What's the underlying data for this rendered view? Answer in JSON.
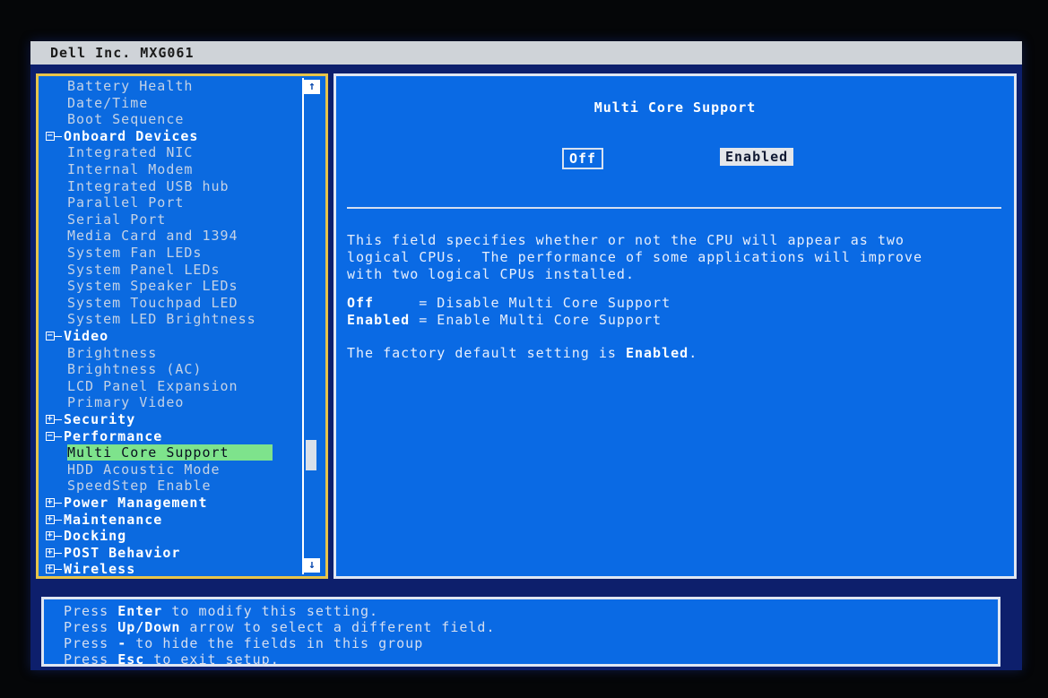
{
  "window": {
    "title": "Dell Inc. MXG061"
  },
  "tree": {
    "items": [
      {
        "label": "Battery Health",
        "level": "sub"
      },
      {
        "label": "Date/Time",
        "level": "sub"
      },
      {
        "label": "Boot Sequence",
        "level": "sub"
      },
      {
        "label": "Onboard Devices",
        "level": "group",
        "expander": "−"
      },
      {
        "label": "Integrated NIC",
        "level": "sub"
      },
      {
        "label": "Internal Modem",
        "level": "sub"
      },
      {
        "label": "Integrated USB hub",
        "level": "sub"
      },
      {
        "label": "Parallel Port",
        "level": "sub"
      },
      {
        "label": "Serial Port",
        "level": "sub"
      },
      {
        "label": "Media Card and 1394",
        "level": "sub"
      },
      {
        "label": "System Fan LEDs",
        "level": "sub"
      },
      {
        "label": "System Panel LEDs",
        "level": "sub"
      },
      {
        "label": "System Speaker LEDs",
        "level": "sub"
      },
      {
        "label": "System Touchpad LED",
        "level": "sub"
      },
      {
        "label": "System LED Brightness",
        "level": "sub"
      },
      {
        "label": "Video",
        "level": "group",
        "expander": "−"
      },
      {
        "label": "Brightness",
        "level": "sub"
      },
      {
        "label": "Brightness (AC)",
        "level": "sub"
      },
      {
        "label": "LCD Panel Expansion",
        "level": "sub"
      },
      {
        "label": "Primary Video",
        "level": "sub"
      },
      {
        "label": "Security",
        "level": "group",
        "expander": "+"
      },
      {
        "label": "Performance",
        "level": "group",
        "expander": "−"
      },
      {
        "label": "Multi Core Support",
        "level": "sub",
        "selected": true
      },
      {
        "label": "HDD Acoustic Mode",
        "level": "sub"
      },
      {
        "label": "SpeedStep Enable",
        "level": "sub"
      },
      {
        "label": "Power Management",
        "level": "group",
        "expander": "+"
      },
      {
        "label": "Maintenance",
        "level": "group",
        "expander": "+"
      },
      {
        "label": "Docking",
        "level": "group",
        "expander": "+"
      },
      {
        "label": "POST Behavior",
        "level": "group",
        "expander": "+"
      },
      {
        "label": "Wireless",
        "level": "group",
        "expander": "+"
      }
    ],
    "scroll_up": "↑",
    "scroll_down": "↓"
  },
  "detail": {
    "title": "Multi Core Support",
    "options": {
      "off": "Off",
      "enabled": "Enabled",
      "selected": "Enabled"
    },
    "description": "This field specifies whether or not the CPU will appear as two\nlogical CPUs.  The performance of some applications will improve\nwith two logical CPUs installed.",
    "definitions": [
      {
        "term": "Off    ",
        "text": " = Disable Multi Core Support"
      },
      {
        "term": "Enabled",
        "text": " = Enable Multi Core Support"
      }
    ],
    "default_prefix": "The factory default setting is ",
    "default_value": "Enabled",
    "default_suffix": "."
  },
  "help": {
    "lines": [
      {
        "pre": "Press ",
        "key": "Enter",
        "post": " to modify this setting."
      },
      {
        "pre": "Press ",
        "key": "Up/Down",
        "post": " arrow to select a different field."
      },
      {
        "pre": "Press ",
        "key": "-",
        "post": " to hide the fields in this group"
      },
      {
        "pre": "Press ",
        "key": "Esc",
        "post": " to exit setup."
      }
    ]
  }
}
